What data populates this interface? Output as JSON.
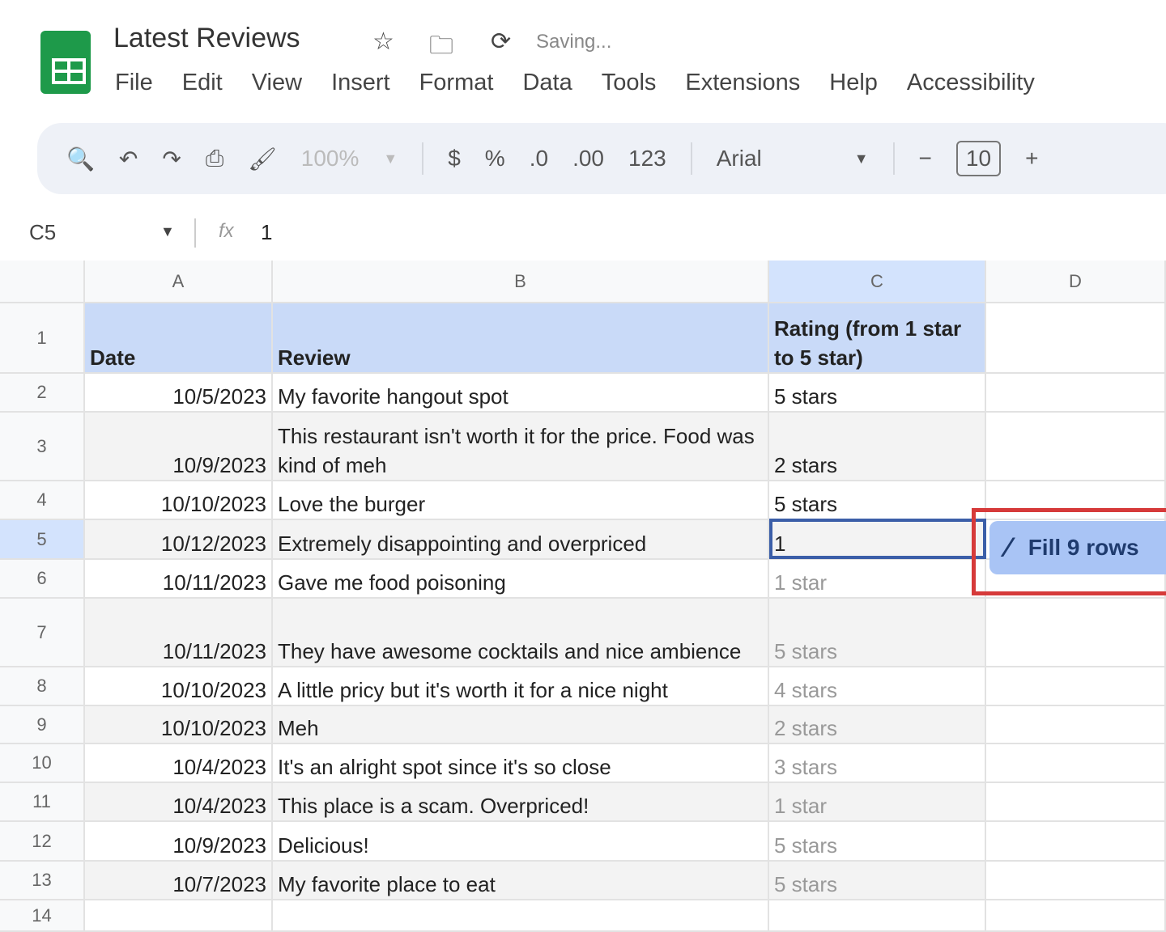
{
  "doc": {
    "title": "Latest Reviews",
    "status": "Saving..."
  },
  "menu": [
    "File",
    "Edit",
    "View",
    "Insert",
    "Format",
    "Data",
    "Tools",
    "Extensions",
    "Help",
    "Accessibility"
  ],
  "toolbar": {
    "zoom": "100%",
    "currency": "$",
    "percent": "%",
    "dec_less": ".0",
    "dec_more": ".00",
    "number_format": "123",
    "font": "Arial",
    "font_size": "10",
    "minus": "−",
    "plus": "+"
  },
  "formula_bar": {
    "cell_ref": "C5",
    "fx": "fx",
    "value": "1"
  },
  "columns": [
    "A",
    "B",
    "C",
    "D"
  ],
  "rows": [
    {
      "n": "1",
      "date": "Date",
      "review": "Review",
      "rating": "Rating (from 1 star to 5 star)"
    },
    {
      "n": "2",
      "date": "10/5/2023",
      "review": "My favorite hangout spot",
      "rating": "5 stars"
    },
    {
      "n": "3",
      "date": "10/9/2023",
      "review": "This restaurant isn't worth it for the price. Food was kind of meh",
      "rating": "2 stars"
    },
    {
      "n": "4",
      "date": "10/10/2023",
      "review": "Love the burger",
      "rating": "5 stars"
    },
    {
      "n": "5",
      "date": "10/12/2023",
      "review": "Extremely disappointing and overpriced",
      "rating": "1"
    },
    {
      "n": "6",
      "date": "10/11/2023",
      "review": "Gave me food poisoning",
      "rating": "1 star"
    },
    {
      "n": "7",
      "date": "10/11/2023",
      "review": "They have awesome cocktails and nice ambience",
      "rating": "5 stars"
    },
    {
      "n": "8",
      "date": "10/10/2023",
      "review": "A little pricy but it's worth it for a nice night",
      "rating": "4 stars"
    },
    {
      "n": "9",
      "date": "10/10/2023",
      "review": "Meh",
      "rating": "2 stars"
    },
    {
      "n": "10",
      "date": "10/4/2023",
      "review": "It's an alright spot since it's so close",
      "rating": "3 stars"
    },
    {
      "n": "11",
      "date": "10/4/2023",
      "review": "This place is a scam. Overpriced!",
      "rating": "1 star"
    },
    {
      "n": "12",
      "date": "10/9/2023",
      "review": "Delicious!",
      "rating": "5 stars"
    },
    {
      "n": "13",
      "date": "10/7/2023",
      "review": "My favorite place to eat",
      "rating": "5 stars"
    },
    {
      "n": "14",
      "date": "",
      "review": "",
      "rating": ""
    }
  ],
  "smart_fill": {
    "label": "Fill 9 rows"
  }
}
